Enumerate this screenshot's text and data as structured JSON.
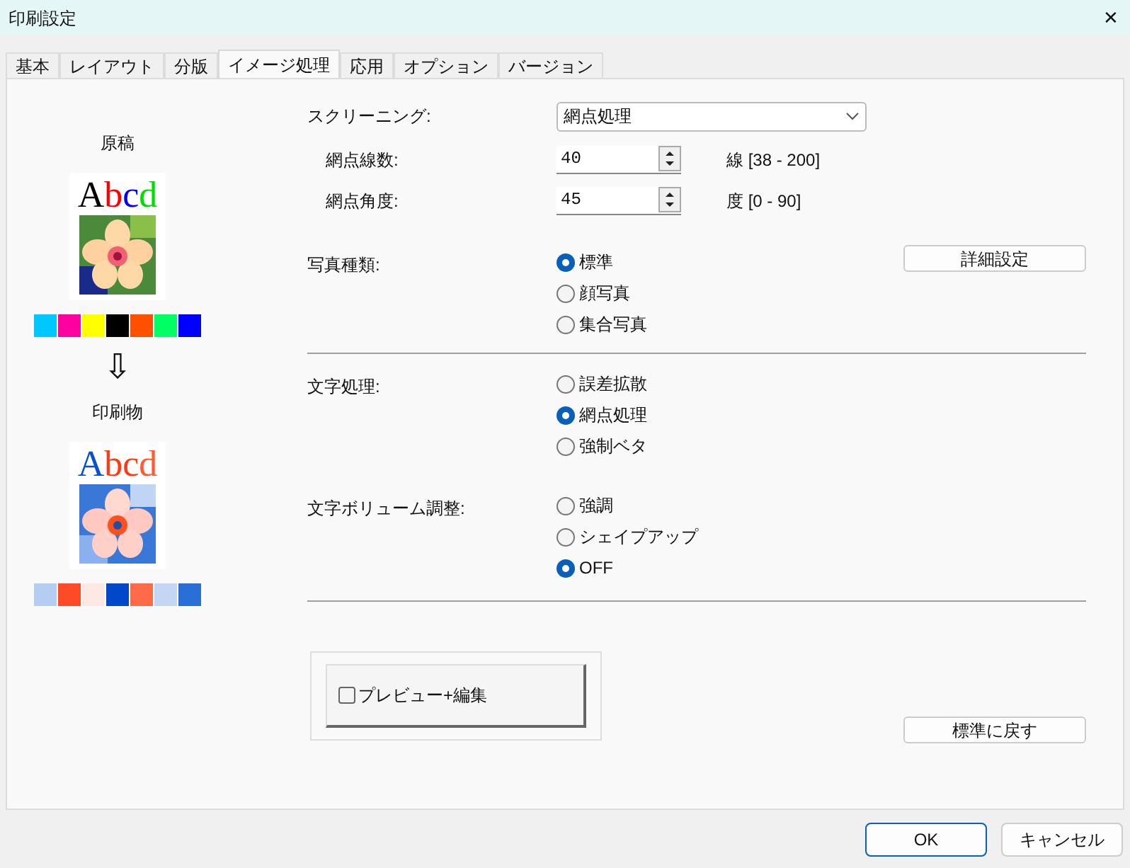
{
  "window": {
    "title": "印刷設定",
    "close": "✕"
  },
  "tabs": [
    {
      "label": "基本",
      "selected": false
    },
    {
      "label": "レイアウト",
      "selected": false
    },
    {
      "label": "分版",
      "selected": false
    },
    {
      "label": "イメージ処理",
      "selected": true
    },
    {
      "label": "応用",
      "selected": false
    },
    {
      "label": "オプション",
      "selected": false
    },
    {
      "label": "バージョン",
      "selected": false
    }
  ],
  "preview": {
    "original": {
      "label": "原稿",
      "sample": [
        {
          "char": "A",
          "color": "#000000"
        },
        {
          "char": "b",
          "color": "#ff0000"
        },
        {
          "char": "c",
          "color": "#0000ff"
        },
        {
          "char": "d",
          "color": "#00dd00"
        }
      ],
      "swatches": [
        {
          "color": "#00c8ff"
        },
        {
          "color": "#ff00a0"
        },
        {
          "color": "#ffff00"
        },
        {
          "color": "#000000"
        },
        {
          "color": "#ff5000"
        },
        {
          "color": "#00ff64"
        },
        {
          "color": "#0000ff"
        }
      ]
    },
    "arrow": "⇩",
    "printed": {
      "label": "印刷物",
      "sample": [
        {
          "char": "A",
          "color": "#0a4fd0"
        },
        {
          "char": "b",
          "color": "#ff3a10"
        },
        {
          "char": "c",
          "color": "#ff3a10"
        },
        {
          "char": "d",
          "color": "#ff5a30"
        }
      ],
      "swatches": [
        {
          "color": "#b4cdf0"
        },
        {
          "color": "#ff4a28"
        },
        {
          "color": "#fde8e4"
        },
        {
          "color": "#0048c8"
        },
        {
          "color": "#ff6a48"
        },
        {
          "color": "#c4d6f4"
        },
        {
          "color": "#2a6ed8"
        }
      ]
    }
  },
  "screening": {
    "label": "スクリーニング:",
    "value": "網点処理"
  },
  "spinners": [
    {
      "label": "網点線数:",
      "value": "40",
      "range": "線 [38 - 200]"
    },
    {
      "label": "網点角度:",
      "value": "45",
      "range": "度 [0 - 90]"
    }
  ],
  "photo_type": {
    "label": "写真種類:",
    "options": [
      {
        "label": "標準",
        "selected": true
      },
      {
        "label": "顔写真",
        "selected": false
      },
      {
        "label": "集合写真",
        "selected": false
      }
    ],
    "button": "詳細設定"
  },
  "text_processing": {
    "label": "文字処理:",
    "options": [
      {
        "label": "誤差拡散",
        "selected": false
      },
      {
        "label": "網点処理",
        "selected": true
      },
      {
        "label": "強制ベタ",
        "selected": false
      }
    ]
  },
  "text_volume": {
    "label": "文字ボリューム調整:",
    "options": [
      {
        "label": "強調",
        "selected": false
      },
      {
        "label": "シェイプアップ",
        "selected": false
      },
      {
        "label": "OFF",
        "selected": true
      }
    ]
  },
  "preview_edit": {
    "label": "プレビュー+編集",
    "checked": false
  },
  "reset_button": "標準に戻す",
  "buttons": [
    {
      "label": "OK",
      "kind": "default"
    },
    {
      "label": "キャンセル",
      "kind": "normal"
    }
  ]
}
